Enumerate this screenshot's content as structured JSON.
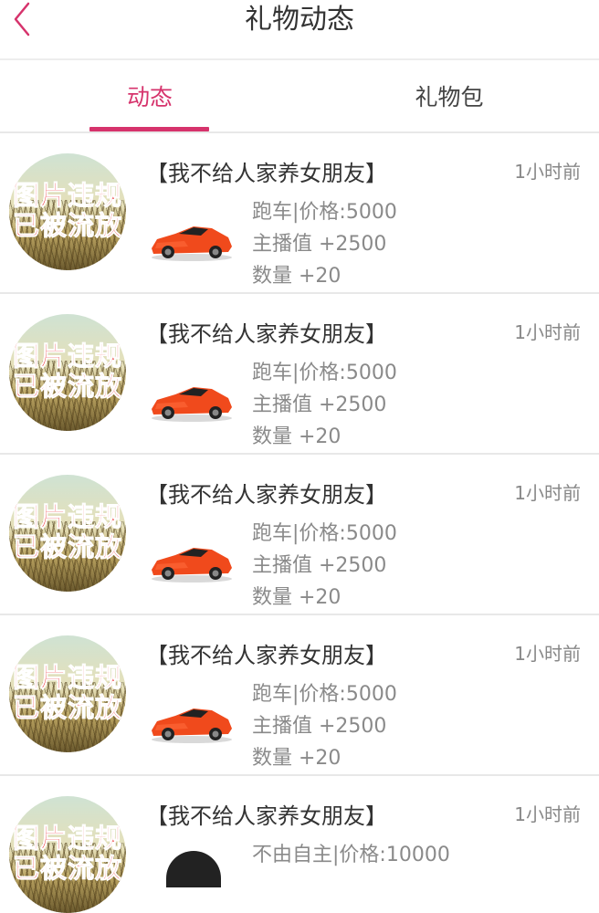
{
  "header": {
    "title": "礼物动态",
    "back_icon": "chevron-left-icon",
    "back_color": "#d6336c"
  },
  "tabs": [
    {
      "label": "动态",
      "active": true
    },
    {
      "label": "礼物包",
      "active": false
    }
  ],
  "accent_color": "#d6336c",
  "avatar_overlay_text": [
    "图片违规",
    "已被流放"
  ],
  "rows": [
    {
      "name": "【我不给人家养女朋友】",
      "time": "1小时前",
      "gift_icon": "sports-car-icon",
      "gift": "跑车|价格:5000",
      "host_value": "主播值 +2500",
      "quantity": "数量 +20"
    },
    {
      "name": "【我不给人家养女朋友】",
      "time": "1小时前",
      "gift_icon": "sports-car-icon",
      "gift": "跑车|价格:5000",
      "host_value": "主播值 +2500",
      "quantity": "数量 +20"
    },
    {
      "name": "【我不给人家养女朋友】",
      "time": "1小时前",
      "gift_icon": "sports-car-icon",
      "gift": "跑车|价格:5000",
      "host_value": "主播值 +2500",
      "quantity": "数量 +20"
    },
    {
      "name": "【我不给人家养女朋友】",
      "time": "1小时前",
      "gift_icon": "sports-car-icon",
      "gift": "跑车|价格:5000",
      "host_value": "主播值 +2500",
      "quantity": "数量 +20"
    },
    {
      "name": "【我不给人家养女朋友】",
      "time": "1小时前",
      "gift_icon": "gift-icon",
      "gift": "不由自主|价格:10000"
    }
  ]
}
